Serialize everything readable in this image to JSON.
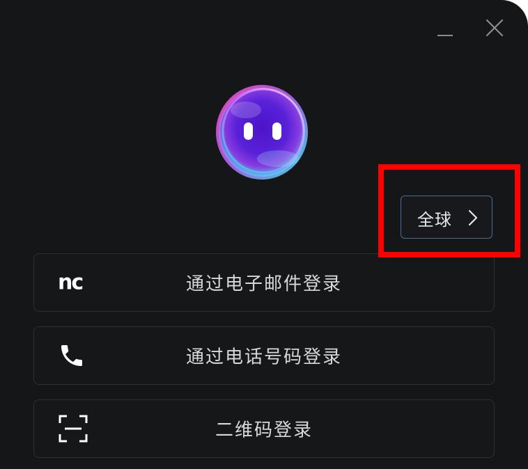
{
  "window": {
    "minimize_icon": "minimize-icon",
    "close_icon": "close-icon"
  },
  "mascot": {
    "icon": "mascot-orb-icon"
  },
  "region": {
    "label": "全球",
    "icon": "chevron-right-icon"
  },
  "login_options": [
    {
      "label": "通过电子邮件登录",
      "icon": "nc-logo",
      "icon_text": "nc"
    },
    {
      "label": "通过电话号码登录",
      "icon": "phone-icon"
    },
    {
      "label": "二维码登录",
      "icon": "qr-scan-icon"
    }
  ],
  "colors": {
    "background": "#151618",
    "button_border": "#2d2f33",
    "region_border": "#4a6f8e",
    "highlight": "#ff0000",
    "text": "#d9d9dc"
  }
}
